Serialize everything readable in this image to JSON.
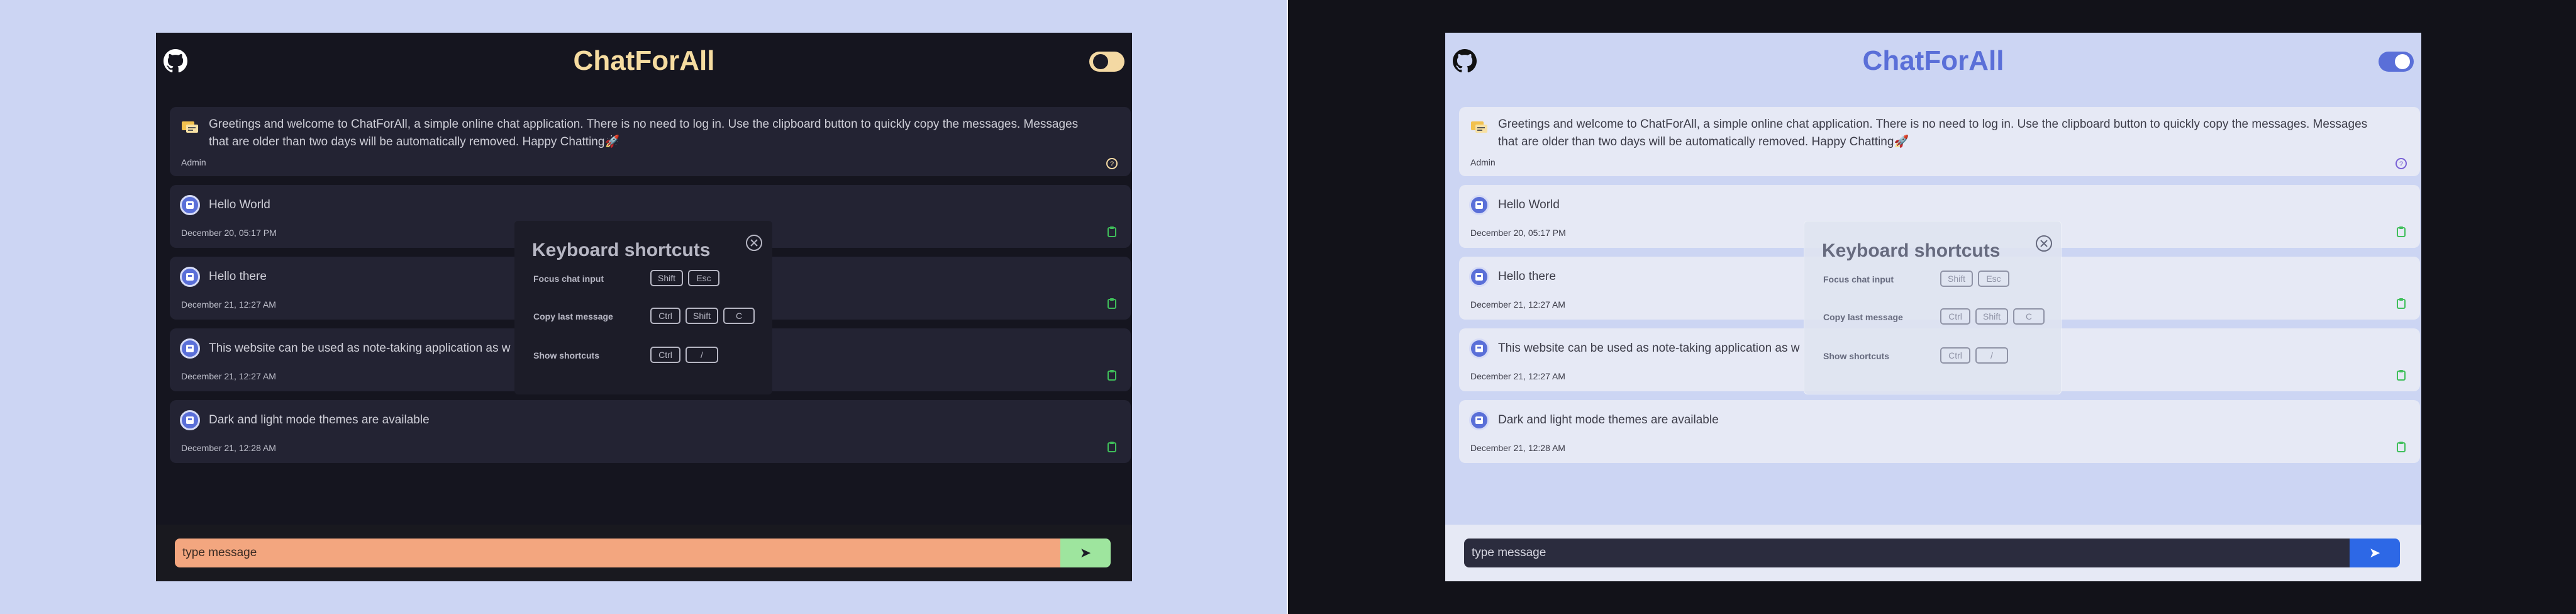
{
  "app": {
    "title": "ChatForAll"
  },
  "messages": [
    {
      "text": "Greetings and welcome to ChatForAll, a simple online chat application. There is no need to log in. Use the clipboard button to quickly copy the messages. Messages that are older than two days will be automatically removed. Happy Chatting🚀",
      "meta": "Admin",
      "action_icon": "help-icon",
      "avatar_icon": "chat-bubble-icon"
    },
    {
      "text": "Hello World",
      "meta": "December 20, 05:17 PM",
      "action_icon": "clipboard-icon",
      "avatar_icon": "user-icon"
    },
    {
      "text": "Hello there",
      "meta": "December 21, 12:27 AM",
      "action_icon": "clipboard-icon",
      "avatar_icon": "user-icon"
    },
    {
      "text": "This website can be used as note-taking application as w",
      "meta": "December 21, 12:27 AM",
      "action_icon": "clipboard-icon",
      "avatar_icon": "user-icon"
    },
    {
      "text": "Dark and light mode themes are available",
      "meta": "December 21, 12:28 AM",
      "action_icon": "clipboard-icon",
      "avatar_icon": "user-icon"
    }
  ],
  "modal": {
    "title": "Keyboard shortcuts",
    "rows": [
      {
        "label": "Focus chat input",
        "keys": [
          "Shift",
          "Esc"
        ]
      },
      {
        "label": "Copy last message",
        "keys": [
          "Ctrl",
          "Shift",
          "C"
        ]
      },
      {
        "label": "Show shortcuts",
        "keys": [
          "Ctrl",
          "/"
        ]
      }
    ]
  },
  "input": {
    "placeholder": "type message",
    "send_icon": "send-icon"
  },
  "colors": {
    "left_page_bg": "#ccd5f3",
    "right_page_bg": "#121219",
    "dark_app_bg": "#15151f",
    "dark_card_bg": "#232333",
    "dark_title": "#f6dca0",
    "dark_input_bg": "#f3a67f",
    "dark_send_bg": "#9ee59e",
    "light_app_bg": "#ccd5f3",
    "light_card_bg": "#e6e9f5",
    "light_title": "#5a6fd8",
    "light_input_bg": "#2b2c3e",
    "light_send_bg": "#2d68e6",
    "clipboard_green": "#3fbf5a"
  }
}
